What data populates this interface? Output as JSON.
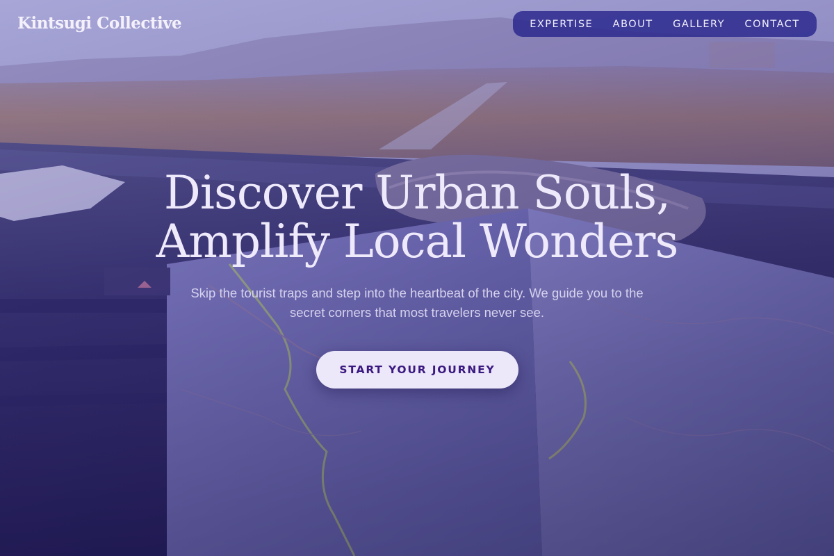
{
  "brand": {
    "name": "Kintsugi Collective"
  },
  "nav": {
    "items": [
      {
        "label": "EXPERTISE"
      },
      {
        "label": "ABOUT"
      },
      {
        "label": "GALLERY"
      },
      {
        "label": "CONTACT"
      }
    ]
  },
  "hero": {
    "headline_line1": "Discover Urban Souls,",
    "headline_line2": "Amplify Local Wonders",
    "subtitle": "Skip the tourist traps and step into the heartbeat of the city. We guide you to the secret corners that most travelers never see.",
    "cta_label": "START YOUR JOURNEY",
    "background_image": "dashboard-road-map-photo"
  },
  "colors": {
    "nav_background": "#28268c",
    "cta_background": "#ece8f9",
    "cta_text": "#3a1880",
    "headline_text": "#efeafb"
  }
}
